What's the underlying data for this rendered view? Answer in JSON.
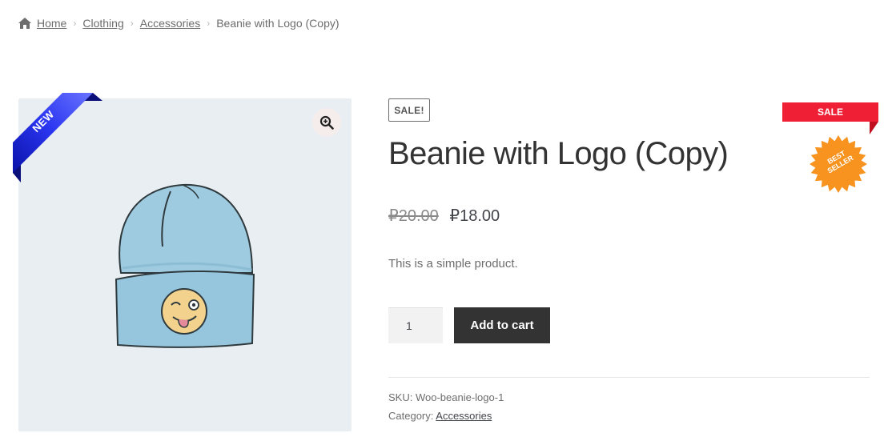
{
  "breadcrumb": {
    "items": [
      "Home",
      "Clothing",
      "Accessories"
    ],
    "current": "Beanie with Logo (Copy)"
  },
  "gallery": {
    "ribbon_text": "NEW",
    "image_alt": "beanie-with-logo-illustration"
  },
  "product": {
    "sale_badge": "SALE!",
    "title": "Beanie with Logo (Copy)",
    "price_old": "₽20.00",
    "price_new": "₽18.00",
    "description": "This is a simple product.",
    "quantity": "1",
    "add_to_cart_label": "Add to cart"
  },
  "meta": {
    "sku_label": "SKU:",
    "sku_value": "Woo-beanie-logo-1",
    "category_label": "Category:",
    "category_value": "Accessories"
  },
  "badges": {
    "sale_corner": "SALE",
    "best_seller": "BEST SELLER"
  },
  "colors": {
    "primary_button": "#333333",
    "sale_red": "#ef1f35",
    "best_seller_orange": "#f7931e",
    "ribbon_blue": "#1a22d6",
    "gallery_bg": "#e9eef2"
  }
}
